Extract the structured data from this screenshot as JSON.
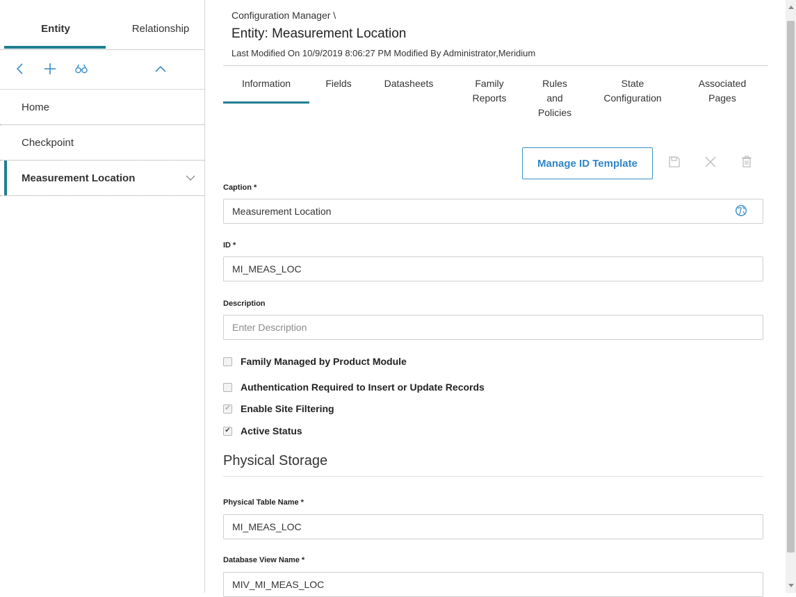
{
  "sidebar": {
    "tabs": {
      "entity": "Entity",
      "relationship": "Relationship"
    },
    "toolbar": {
      "back_icon": "chevron-left-icon",
      "add_icon": "plus-icon",
      "search_icon": "binoculars-icon",
      "collapse_icon": "chevron-up-icon"
    },
    "items": [
      {
        "label": "Home"
      },
      {
        "label": "Checkpoint"
      },
      {
        "label": "Measurement Location"
      }
    ]
  },
  "header": {
    "breadcrumb": "Configuration Manager \\",
    "title": "Entity: Measurement Location",
    "modified": "Last Modified On 10/9/2019 8:06:27 PM Modified By Administrator,Meridium"
  },
  "tabs": {
    "information": "Information",
    "fields": "Fields",
    "datasheets": "Datasheets",
    "family_reports": [
      "Family",
      "Reports"
    ],
    "rules_policies": [
      "Rules",
      "and",
      "Policies"
    ],
    "state_configuration": [
      "State",
      "Configuration"
    ],
    "associated_pages": [
      "Associated",
      "Pages"
    ]
  },
  "actions": {
    "manage_id_template": "Manage ID Template",
    "save_icon": "save-icon",
    "cancel_icon": "close-icon",
    "delete_icon": "trash-icon"
  },
  "form": {
    "caption_label": "Caption *",
    "caption_value": "Measurement Location",
    "id_label": "ID *",
    "id_value": "MI_MEAS_LOC",
    "description_label": "Description",
    "description_placeholder": "Enter Description",
    "checkboxes": [
      {
        "label": "Family Managed by Product Module",
        "checked": false,
        "disabled": false
      },
      {
        "label": "Authentication Required to Insert or Update Records",
        "checked": false,
        "disabled": false
      },
      {
        "label": "Enable Site Filtering",
        "checked": true,
        "disabled": true
      },
      {
        "label": "Active Status",
        "checked": true,
        "disabled": false
      }
    ],
    "physical_storage_title": "Physical Storage",
    "physical_table_label": "Physical Table Name *",
    "physical_table_value": "MI_MEAS_LOC",
    "database_view_label": "Database View Name *",
    "database_view_value": "MIV_MI_MEAS_LOC"
  },
  "colors": {
    "accent": "#1f7f91",
    "link_blue": "#2f86c5"
  }
}
